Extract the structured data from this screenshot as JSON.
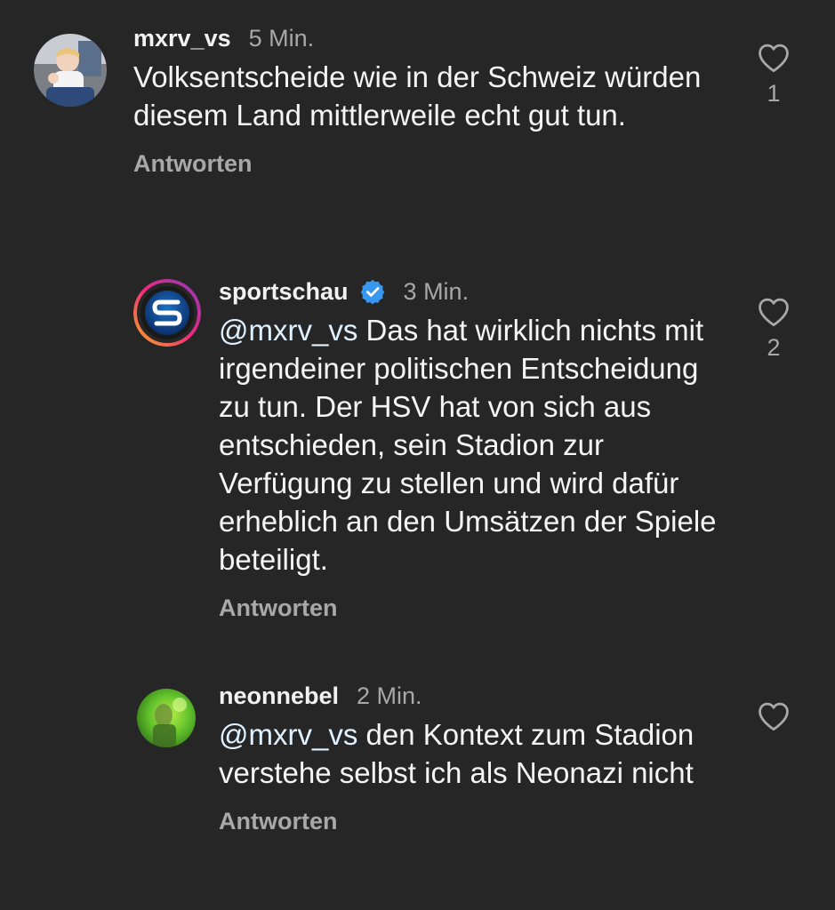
{
  "comments": [
    {
      "username": "mxrv_vs",
      "timestamp": "5 Min.",
      "text": "Volksentscheide wie in der Schweiz würden diesem Land mittlerweile echt gut tun.",
      "reply_label": "Antworten",
      "like_count": "1",
      "verified": false
    },
    {
      "username": "sportschau",
      "timestamp": "3 Min.",
      "mention": "@mxrv_vs",
      "text": "Das hat wirklich nichts mit irgendeiner politischen Entscheidung zu tun. Der HSV hat von sich aus entschieden, sein Stadion zur Verfügung zu stellen und wird dafür erheblich an den Umsätzen der Spiele beteiligt.",
      "reply_label": "Antworten",
      "like_count": "2",
      "verified": true
    },
    {
      "username": "neonnebel",
      "timestamp": "2 Min.",
      "mention": "@mxrv_vs",
      "text": "den Kontext zum Stadion verstehe selbst ich als Neonazi nicht",
      "reply_label": "Antworten",
      "like_count": "",
      "verified": false
    }
  ],
  "icons": {
    "like": "heart-outline-icon",
    "verified": "verified-badge-icon"
  },
  "colors": {
    "background": "#262626",
    "text": "#f5f5f5",
    "secondary_text": "#a8a8a8",
    "verified_blue": "#3897f0",
    "mention": "#e0f1ff"
  }
}
